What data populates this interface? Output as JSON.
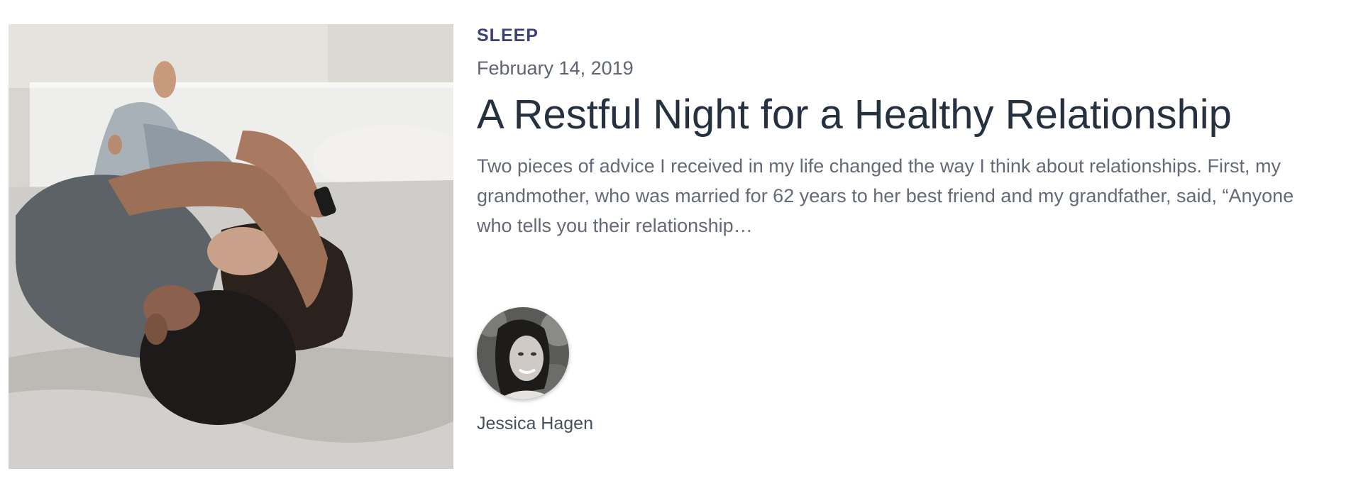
{
  "article": {
    "category": "SLEEP",
    "date": "February 14, 2019",
    "title": "A Restful Night for a Healthy Relationship",
    "excerpt": "Two pieces of advice I received in my life changed the way I think about relationships.   First, my grandmother, who was married for 62 years to her best friend and my grandfather, said, “Anyone who tells you their relationship…",
    "author": {
      "name": "Jessica Hagen"
    }
  },
  "colors": {
    "category": "#3c4275",
    "title": "#26313f",
    "text": "#646a75"
  }
}
